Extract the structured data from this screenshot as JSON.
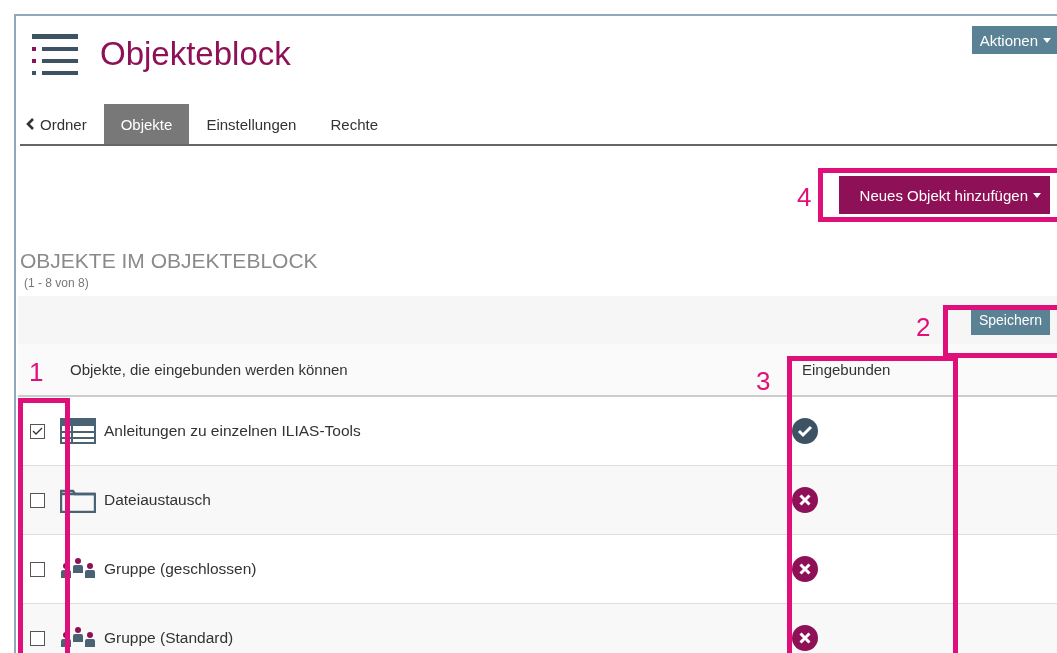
{
  "header": {
    "title": "Objekteblock",
    "actions_button": "Aktionen"
  },
  "tabs": [
    {
      "label": "Ordner",
      "kind": "back",
      "selected": false
    },
    {
      "label": "Objekte",
      "kind": "tab",
      "selected": true
    },
    {
      "label": "Einstellungen",
      "kind": "tab",
      "selected": false
    },
    {
      "label": "Rechte",
      "kind": "tab",
      "selected": false
    }
  ],
  "add_button": "Neues Objekt hinzufügen",
  "section": {
    "title": "OBJEKTE IM OBJEKTEBLOCK",
    "count": "(1 - 8 von 8)"
  },
  "save_button": "Speichern",
  "table": {
    "columns": [
      "Objekte, die eingebunden werden können",
      "Eingebunden"
    ],
    "rows": [
      {
        "kind": "table",
        "name": "Anleitungen zu einzelnen ILIAS-Tools",
        "checked": true,
        "included": true
      },
      {
        "kind": "folder",
        "name": "Dateiaustausch",
        "checked": false,
        "included": false
      },
      {
        "kind": "group",
        "name": "Gruppe (geschlossen)",
        "checked": false,
        "included": false
      },
      {
        "kind": "group",
        "name": "Gruppe (Standard)",
        "checked": false,
        "included": false
      }
    ]
  },
  "annotations": [
    {
      "label": "1"
    },
    {
      "label": "2"
    },
    {
      "label": "3"
    },
    {
      "label": "4"
    }
  ]
}
